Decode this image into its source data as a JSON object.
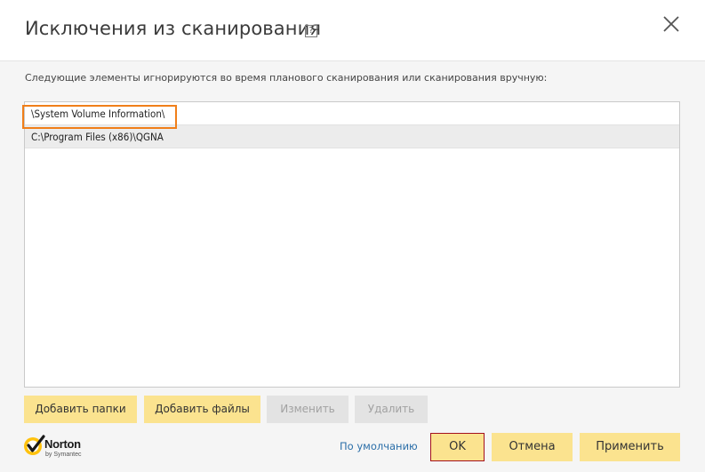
{
  "dialog": {
    "title": "Исключения из сканирования",
    "help_glyph": "?",
    "description": "Следующие элементы игнорируются во время планового сканирования или сканирования вручную:"
  },
  "exclusions": {
    "items": [
      "\\System Volume Information\\",
      "C:\\Program Files (x86)\\QGNA"
    ],
    "selected_index": 1
  },
  "list_buttons": {
    "add_folders": "Добавить папки",
    "add_files": "Добавить файлы",
    "edit": "Изменить",
    "delete": "Удалить"
  },
  "footer": {
    "logo_name": "Norton",
    "logo_sub": "by Symantec",
    "default_link": "По умолчанию",
    "ok": "OK",
    "cancel": "Отмена",
    "apply": "Применить"
  },
  "colors": {
    "button_yellow": "#fbe38f",
    "button_disabled": "#e3e3e3",
    "selection_outline": "#f07f1a",
    "ok_border": "#a3101f",
    "link": "#2a6ea8"
  }
}
